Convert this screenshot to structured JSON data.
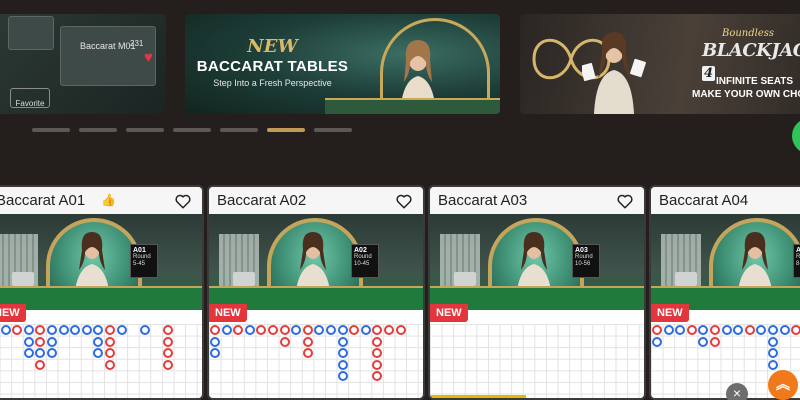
{
  "banners": [
    {
      "id": "favorite-banner",
      "mini_label": "Baccarat M01",
      "count_label": "231",
      "favorite_label": "Favorite"
    },
    {
      "id": "new-baccarat",
      "new_label": "NEW",
      "title": "BACCARAT TABLES",
      "subtitle": "Step Into a Fresh Perspective"
    },
    {
      "id": "boundless-blackjack",
      "top_label": "Boundless",
      "title_main": "BLACKJACK",
      "title_num": "4",
      "line1": "INFINITE SEATS",
      "line2": "MAKE YOUR OWN CHO"
    }
  ],
  "carousel": {
    "total": 7,
    "active": 6
  },
  "tables": [
    {
      "name": "Baccarat A01",
      "has_thumb": true,
      "badge": "NEW",
      "panel_id": "A01",
      "panel_line1": "Round",
      "panel_line2": "5-45",
      "beads": [
        {
          "c": 0,
          "r": 0,
          "t": "p"
        },
        {
          "c": 1,
          "r": 0,
          "t": "b"
        },
        {
          "c": 2,
          "r": 0,
          "t": "p"
        },
        {
          "c": 3,
          "r": 0,
          "t": "b"
        },
        {
          "c": 4,
          "r": 0,
          "t": "p"
        },
        {
          "c": 5,
          "r": 0,
          "t": "b"
        },
        {
          "c": 6,
          "r": 0,
          "t": "b"
        },
        {
          "c": 7,
          "r": 0,
          "t": "b"
        },
        {
          "c": 8,
          "r": 0,
          "t": "b"
        },
        {
          "c": 9,
          "r": 0,
          "t": "b"
        },
        {
          "c": 10,
          "r": 0,
          "t": "p"
        },
        {
          "c": 11,
          "r": 0,
          "t": "b"
        },
        {
          "c": 13,
          "r": 0,
          "t": "b"
        },
        {
          "c": 15,
          "r": 0,
          "t": "p"
        },
        {
          "c": 0,
          "r": 1,
          "t": "b"
        },
        {
          "c": 3,
          "r": 1,
          "t": "b"
        },
        {
          "c": 4,
          "r": 1,
          "t": "p"
        },
        {
          "c": 5,
          "r": 1,
          "t": "b"
        },
        {
          "c": 9,
          "r": 1,
          "t": "b"
        },
        {
          "c": 10,
          "r": 1,
          "t": "p"
        },
        {
          "c": 15,
          "r": 1,
          "t": "p"
        },
        {
          "c": 0,
          "r": 2,
          "t": "b"
        },
        {
          "c": 3,
          "r": 2,
          "t": "b"
        },
        {
          "c": 4,
          "r": 2,
          "t": "b"
        },
        {
          "c": 5,
          "r": 2,
          "t": "b"
        },
        {
          "c": 9,
          "r": 2,
          "t": "b"
        },
        {
          "c": 10,
          "r": 2,
          "t": "p"
        },
        {
          "c": 15,
          "r": 2,
          "t": "p"
        },
        {
          "c": 0,
          "r": 3,
          "t": "b"
        },
        {
          "c": 4,
          "r": 3,
          "t": "p"
        },
        {
          "c": 10,
          "r": 3,
          "t": "p"
        },
        {
          "c": 15,
          "r": 3,
          "t": "p"
        }
      ]
    },
    {
      "name": "Baccarat A02",
      "has_thumb": false,
      "badge": "NEW",
      "panel_id": "A02",
      "panel_line1": "Round",
      "panel_line2": "10-45",
      "beads": [
        {
          "c": 0,
          "r": 0,
          "t": "p"
        },
        {
          "c": 1,
          "r": 0,
          "t": "b"
        },
        {
          "c": 2,
          "r": 0,
          "t": "p"
        },
        {
          "c": 3,
          "r": 0,
          "t": "b"
        },
        {
          "c": 4,
          "r": 0,
          "t": "p"
        },
        {
          "c": 5,
          "r": 0,
          "t": "p"
        },
        {
          "c": 6,
          "r": 0,
          "t": "p"
        },
        {
          "c": 7,
          "r": 0,
          "t": "b"
        },
        {
          "c": 8,
          "r": 0,
          "t": "p"
        },
        {
          "c": 9,
          "r": 0,
          "t": "b"
        },
        {
          "c": 10,
          "r": 0,
          "t": "b"
        },
        {
          "c": 11,
          "r": 0,
          "t": "b"
        },
        {
          "c": 12,
          "r": 0,
          "t": "p"
        },
        {
          "c": 13,
          "r": 0,
          "t": "b"
        },
        {
          "c": 14,
          "r": 0,
          "t": "p"
        },
        {
          "c": 15,
          "r": 0,
          "t": "p"
        },
        {
          "c": 16,
          "r": 0,
          "t": "p"
        },
        {
          "c": 0,
          "r": 1,
          "t": "b"
        },
        {
          "c": 6,
          "r": 1,
          "t": "p"
        },
        {
          "c": 8,
          "r": 1,
          "t": "p"
        },
        {
          "c": 11,
          "r": 1,
          "t": "b"
        },
        {
          "c": 14,
          "r": 1,
          "t": "p"
        },
        {
          "c": 0,
          "r": 2,
          "t": "b"
        },
        {
          "c": 8,
          "r": 2,
          "t": "p"
        },
        {
          "c": 11,
          "r": 2,
          "t": "b"
        },
        {
          "c": 14,
          "r": 2,
          "t": "p"
        },
        {
          "c": 11,
          "r": 3,
          "t": "b"
        },
        {
          "c": 14,
          "r": 3,
          "t": "p"
        },
        {
          "c": 11,
          "r": 4,
          "t": "b"
        },
        {
          "c": 14,
          "r": 4,
          "t": "p"
        }
      ]
    },
    {
      "name": "Baccarat A03",
      "has_thumb": false,
      "badge": "NEW",
      "panel_id": "A03",
      "panel_line1": "Round",
      "panel_line2": "10-56",
      "progress": 0.45,
      "beads": []
    },
    {
      "name": "Baccarat A04",
      "has_thumb": false,
      "badge": "NEW",
      "panel_id": "A04",
      "panel_line1": "Round",
      "panel_line2": "8-22",
      "beads": [
        {
          "c": 0,
          "r": 0,
          "t": "p"
        },
        {
          "c": 1,
          "r": 0,
          "t": "b"
        },
        {
          "c": 2,
          "r": 0,
          "t": "b"
        },
        {
          "c": 3,
          "r": 0,
          "t": "p"
        },
        {
          "c": 4,
          "r": 0,
          "t": "b"
        },
        {
          "c": 5,
          "r": 0,
          "t": "p"
        },
        {
          "c": 6,
          "r": 0,
          "t": "b"
        },
        {
          "c": 7,
          "r": 0,
          "t": "b"
        },
        {
          "c": 8,
          "r": 0,
          "t": "p"
        },
        {
          "c": 9,
          "r": 0,
          "t": "b"
        },
        {
          "c": 10,
          "r": 0,
          "t": "b"
        },
        {
          "c": 11,
          "r": 0,
          "t": "b"
        },
        {
          "c": 12,
          "r": 0,
          "t": "p"
        },
        {
          "c": 0,
          "r": 1,
          "t": "b"
        },
        {
          "c": 4,
          "r": 1,
          "t": "b"
        },
        {
          "c": 5,
          "r": 1,
          "t": "p"
        },
        {
          "c": 10,
          "r": 1,
          "t": "b"
        },
        {
          "c": 10,
          "r": 2,
          "t": "b"
        },
        {
          "c": 10,
          "r": 3,
          "t": "b"
        }
      ]
    }
  ],
  "colors": {
    "banker": "#2d6ce0",
    "player": "#e23d3d",
    "accent": "#c09a57"
  },
  "icons": {
    "heart": "heart-outline-icon",
    "thumb": "thumbs-up-icon",
    "close": "close-icon",
    "scroll_top": "chevrons-up-icon"
  }
}
